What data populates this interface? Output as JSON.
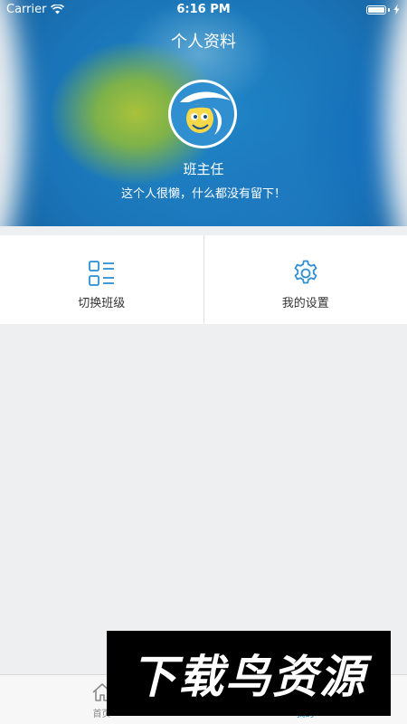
{
  "status_bar": {
    "carrier": "Carrier",
    "time": "6:16 PM"
  },
  "header": {
    "title": "个人资料"
  },
  "profile": {
    "name": "班主任",
    "bio": "这个人很懒，什么都没有留下！"
  },
  "actions": [
    {
      "label": "切换班级",
      "icon": "grid-list-icon"
    },
    {
      "label": "我的设置",
      "icon": "gear-icon"
    }
  ],
  "tab_bar": {
    "items": [
      {
        "label": "首页",
        "icon": "home-icon",
        "active": false
      },
      {
        "label": "我的",
        "icon": "user-icon",
        "active": true
      }
    ]
  },
  "watermark": {
    "text": "下载鸟资源"
  },
  "colors": {
    "accent": "#2a96d6",
    "icon_blue": "#2f8fd0",
    "background": "#eeeff1",
    "tile_background": "#ffffff",
    "tab_inactive": "#8a8a8a"
  }
}
